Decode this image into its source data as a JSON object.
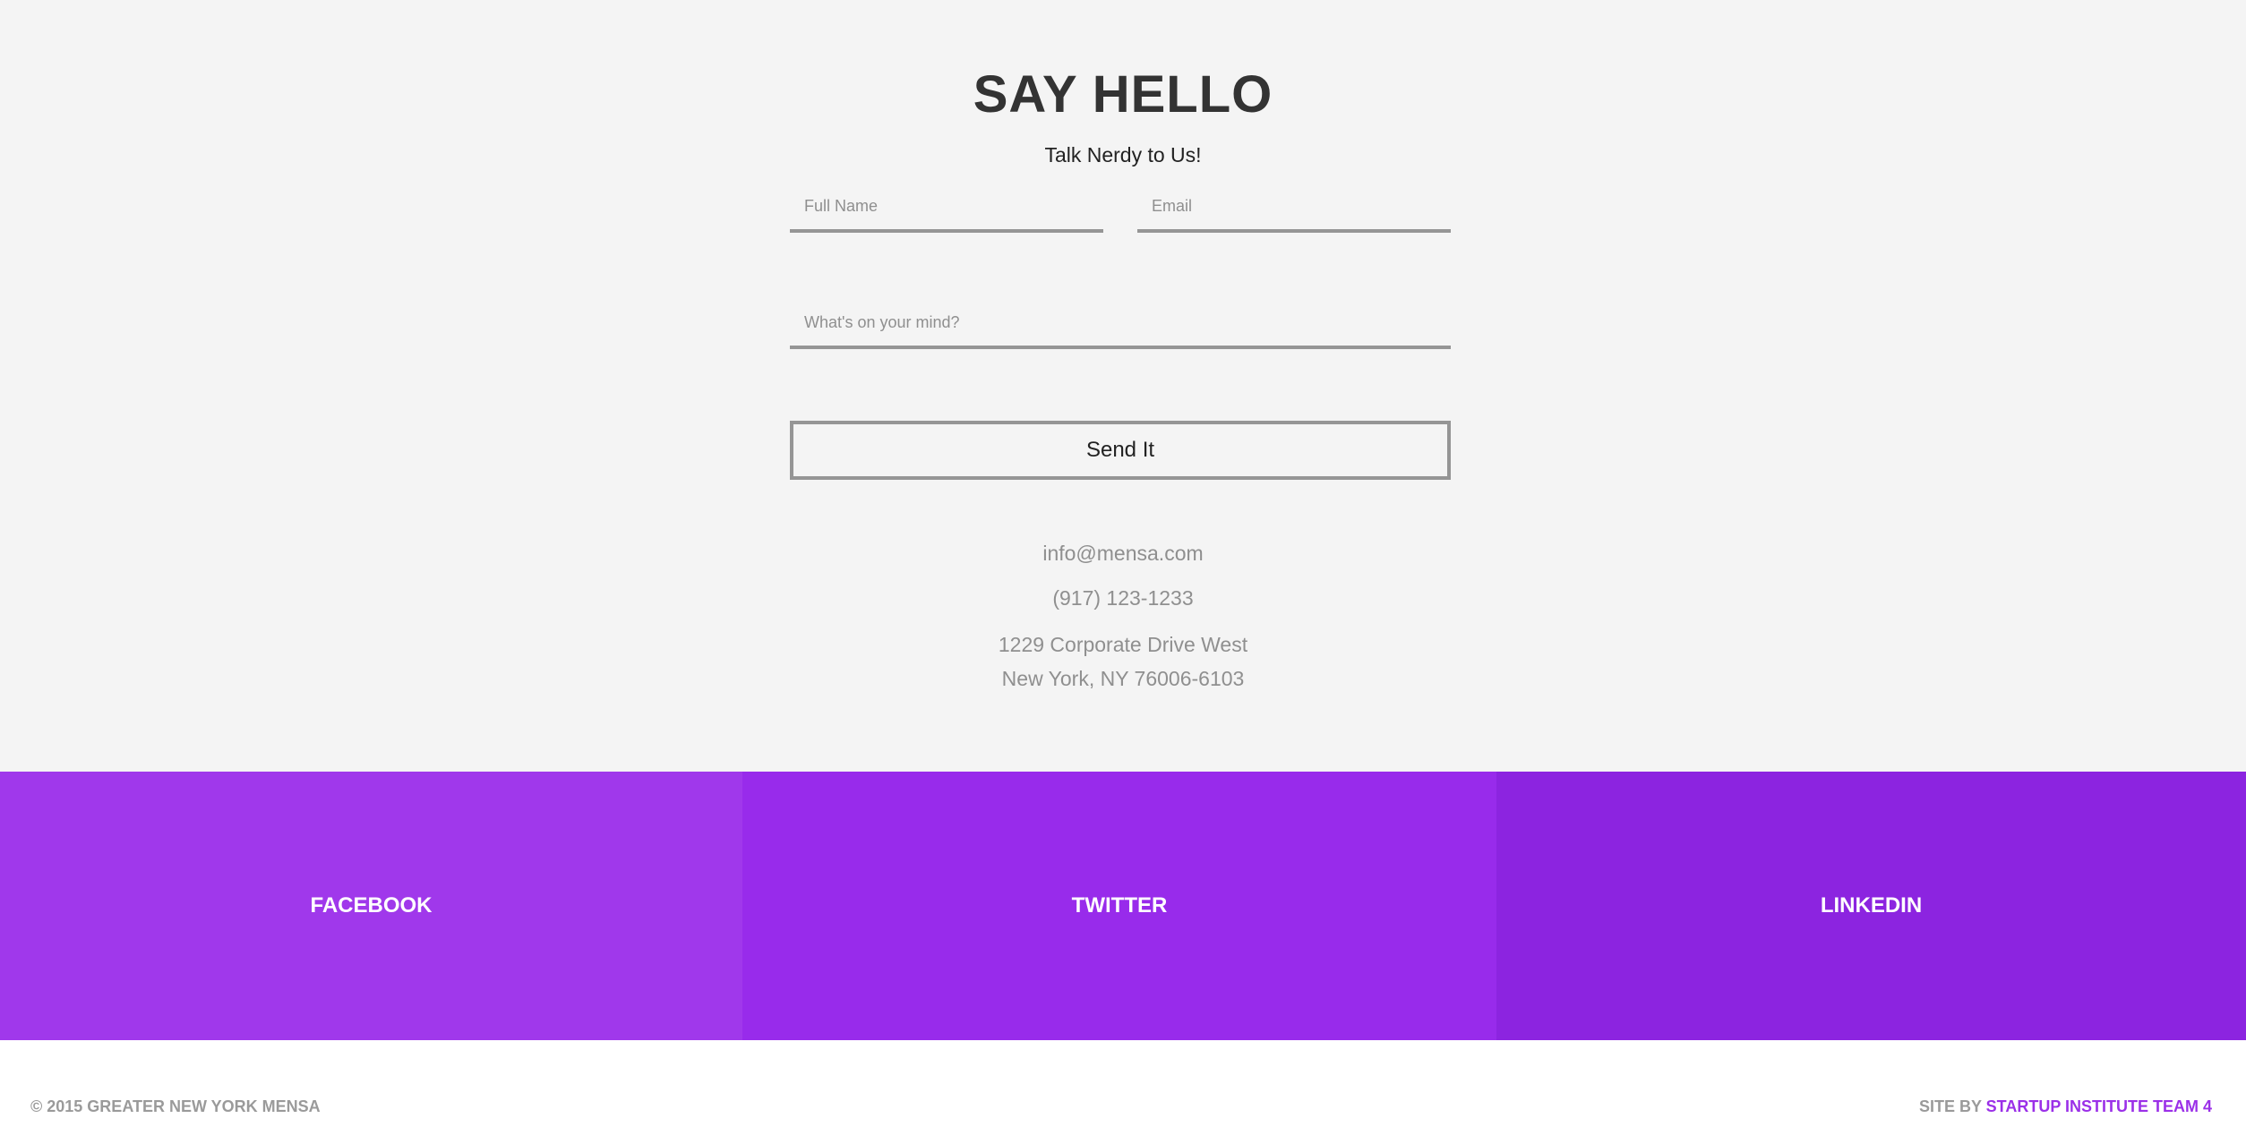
{
  "contact": {
    "title": "SAY HELLO",
    "subtitle": "Talk Nerdy to Us!",
    "form": {
      "name_placeholder": "Full Name",
      "email_placeholder": "Email",
      "message_placeholder": "What's on your mind?",
      "submit_label": "Send It"
    },
    "info": {
      "email": "info@mensa.com",
      "phone": "(917) 123-1233",
      "address_line1": "1229 Corporate Drive West",
      "address_line2": "New York, NY 76006-6103"
    }
  },
  "social": {
    "facebook": {
      "label": "FACEBOOK",
      "color": "#a038eb"
    },
    "twitter": {
      "label": "TWITTER",
      "color": "#982beb"
    },
    "linkedin": {
      "label": "LINKEDIN",
      "color": "#8c24e0"
    }
  },
  "footer": {
    "copyright": "© 2015 GREATER NEW YORK MENSA",
    "credit_prefix": "SITE BY",
    "credit_link": "STARTUP INSTITUTE TEAM 4",
    "accent_color": "#9b30e8"
  }
}
